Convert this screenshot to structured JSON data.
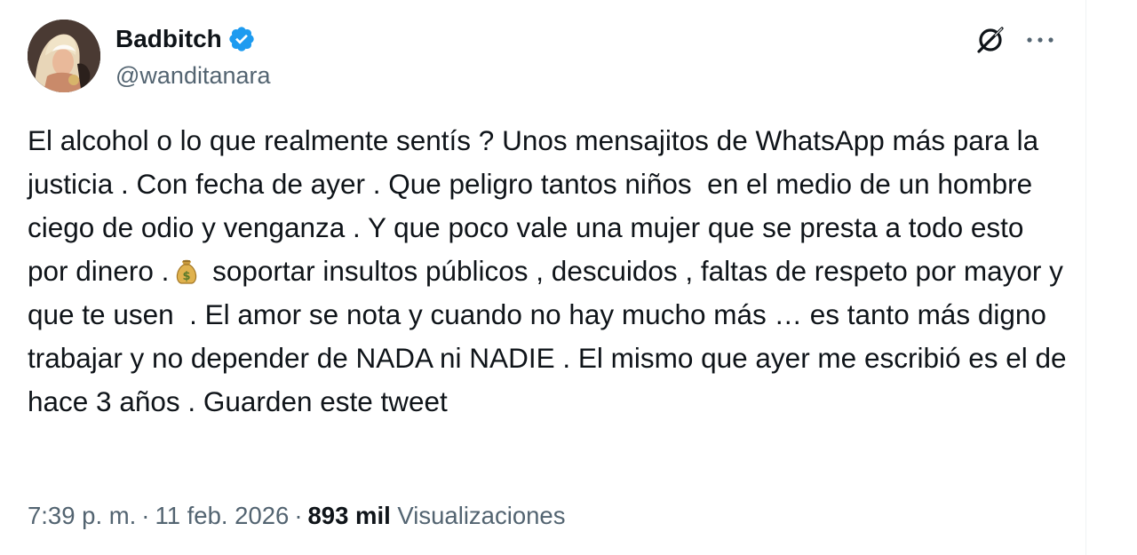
{
  "author": {
    "display_name": "Badbitch",
    "handle": "@wanditanara",
    "verified": true,
    "verified_color": "#1d9bf0",
    "avatar_icon": "profile-photo"
  },
  "actions": {
    "grok_icon": "grok-icon",
    "more_icon": "more-options-icon"
  },
  "tweet": {
    "text_before_emoji": "El alcohol o lo que realmente sentís ? Unos mensajitos de WhatsApp más para la justicia . Con fecha de ayer . Que peligro tantos niños  en el medio de un hombre ciego de odio y venganza . Y que poco vale una mujer que se presta a todo esto por dinero .",
    "emoji": "money-bag-emoji",
    "text_after_emoji": " soportar insultos públicos , descuidos , faltas de respeto por mayor y  que te usen  . El amor se nota y cuando no hay mucho más … es tanto más digno trabajar y no depender de NADA ni NADIE . El mismo que ayer me escribió es el de hace 3 años . Guarden este tweet"
  },
  "meta": {
    "time": "7:39 p. m.",
    "separator": "·",
    "date": "11 feb. 2026",
    "views_count": "893 mil",
    "views_label": "Visualizaciones"
  },
  "colors": {
    "text_primary": "#0f1419",
    "text_secondary": "#536471",
    "accent": "#1d9bf0"
  }
}
